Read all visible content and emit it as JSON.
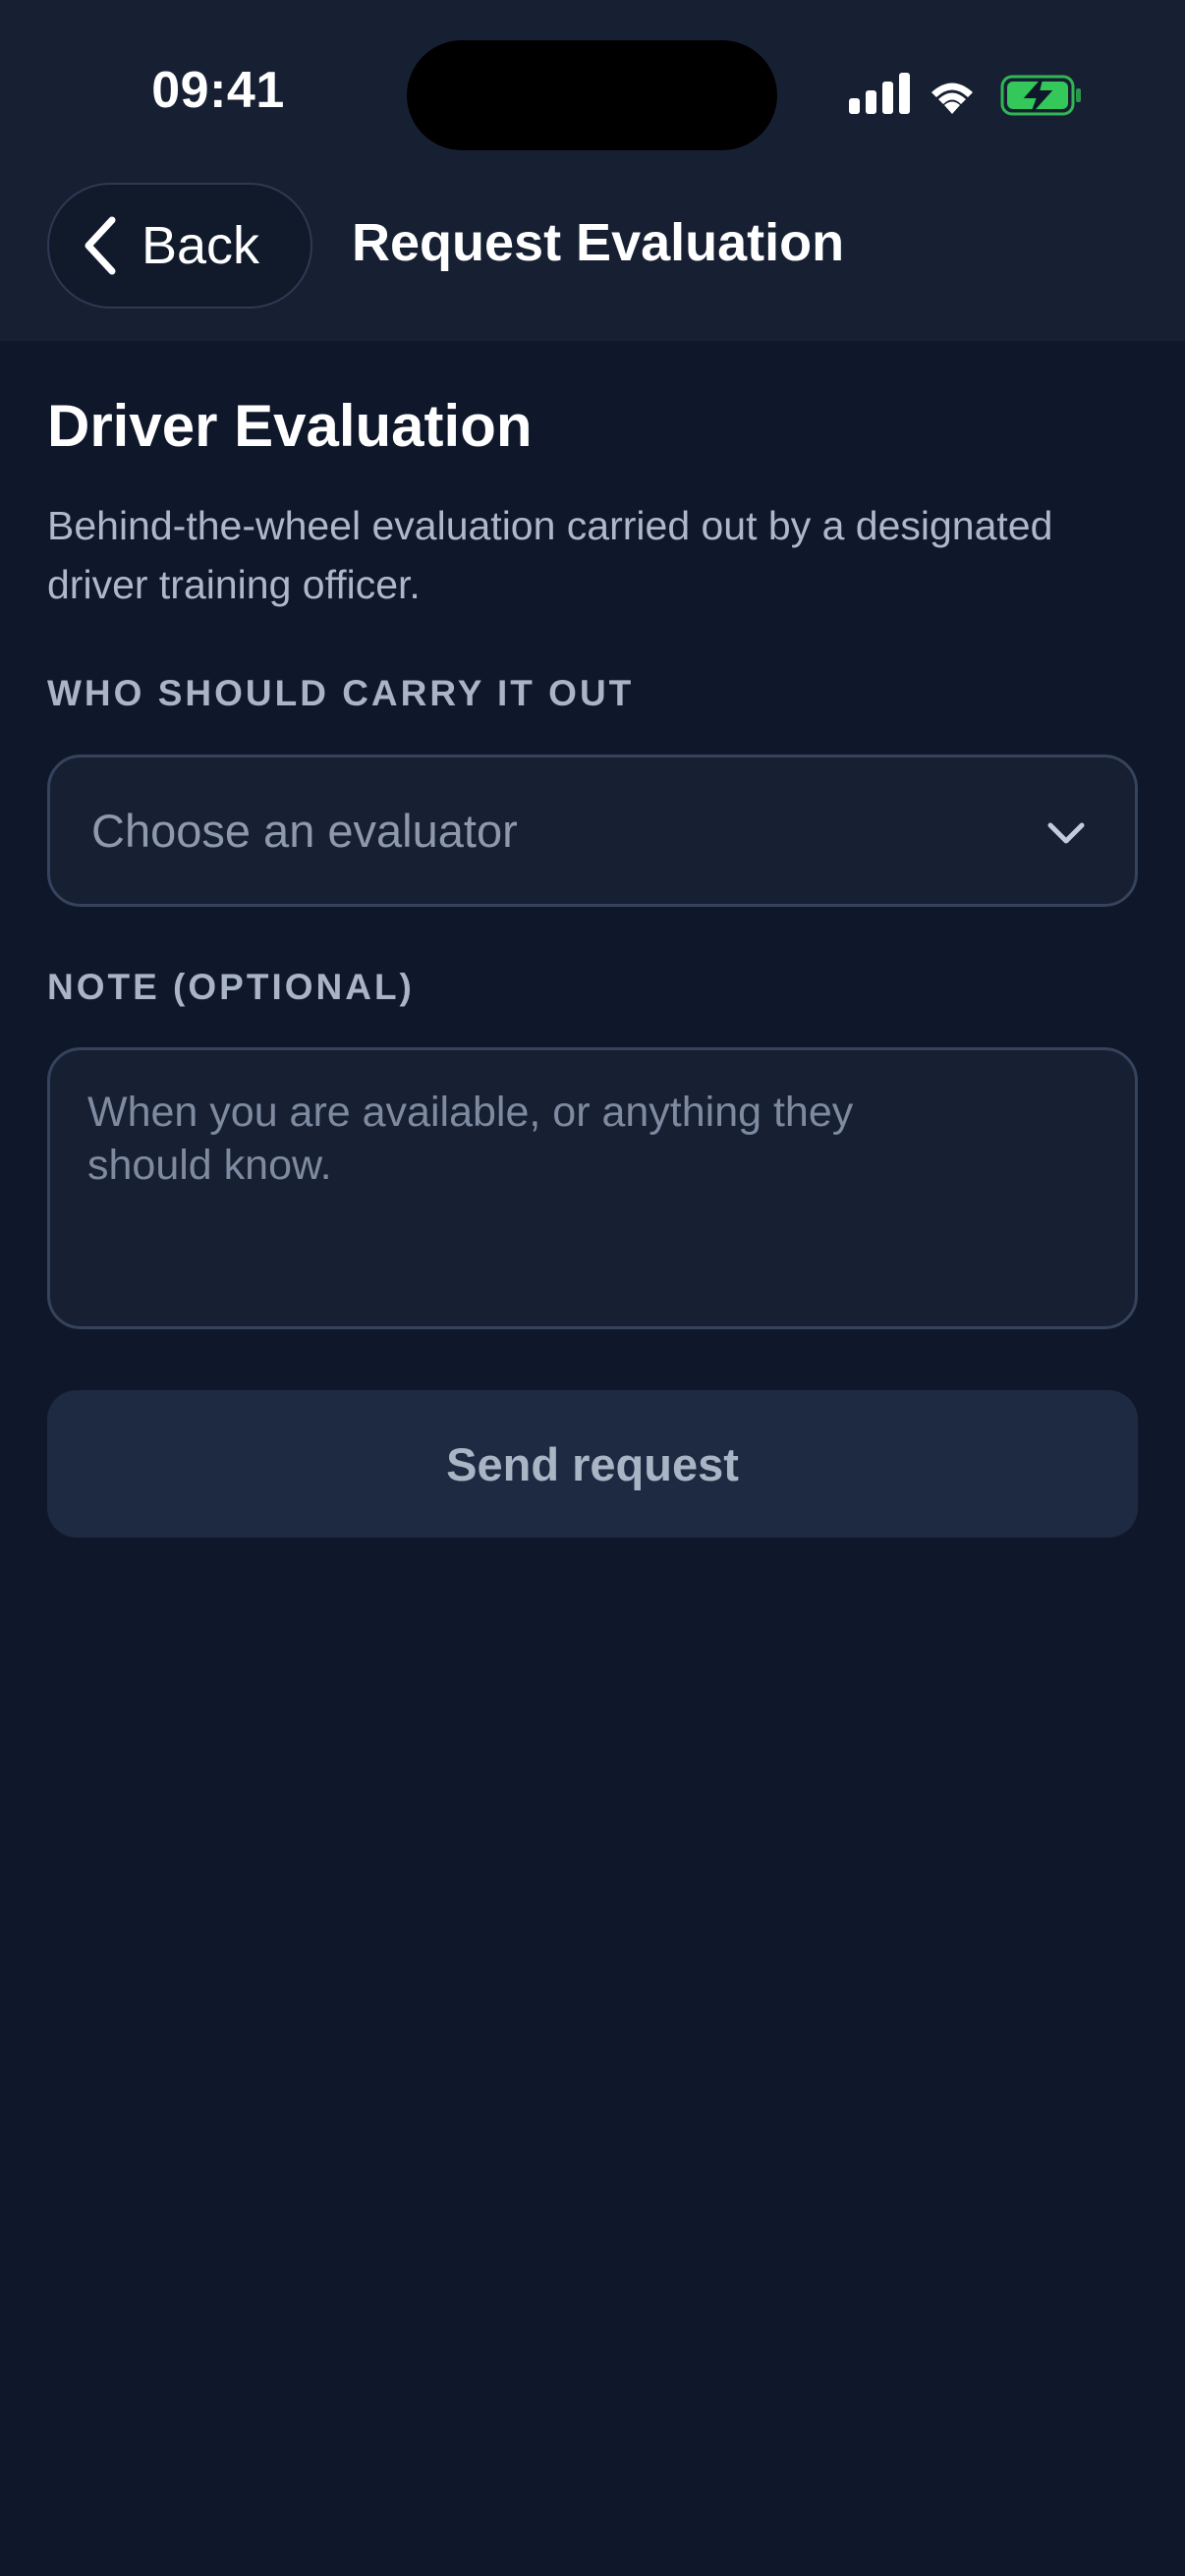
{
  "status_bar": {
    "time": "09:41",
    "battery_color": "#34c759"
  },
  "nav": {
    "back_label": "Back",
    "title": "Request Evaluation"
  },
  "section": {
    "title": "Driver Evaluation",
    "description": "Behind-the-wheel evaluation carried out by a designated driver training officer."
  },
  "evaluator": {
    "label": "WHO SHOULD CARRY IT OUT",
    "placeholder": "Choose an evaluator"
  },
  "note": {
    "label": "NOTE (OPTIONAL)",
    "placeholder": "When you are available, or anything they should know."
  },
  "submit": {
    "label": "Send request"
  },
  "colors": {
    "background": "#0f172a",
    "surface": "#172033",
    "button_disabled": "#1e2a42",
    "muted_text": "#a9b4c5"
  }
}
